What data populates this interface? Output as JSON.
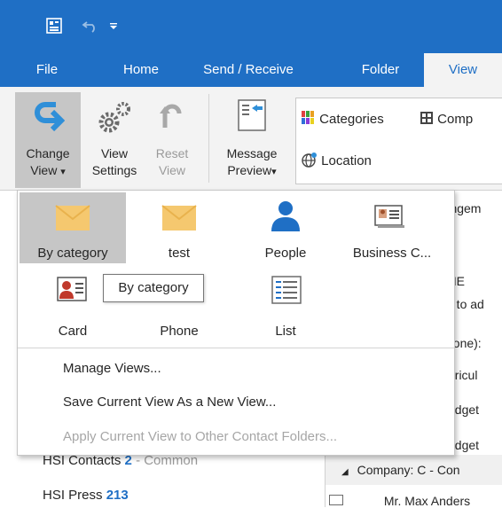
{
  "quick_access": {
    "icons": [
      "outlook-icon",
      "undo-icon",
      "customize-qat-icon"
    ]
  },
  "tabs": [
    "File",
    "Home",
    "Send / Receive",
    "Folder",
    "View"
  ],
  "active_tab": "View",
  "ribbon": {
    "change_view": {
      "line1": "Change",
      "line2": "View",
      "arrow": "▾"
    },
    "view_settings": {
      "line1": "View",
      "line2": "Settings"
    },
    "reset_view": {
      "line1": "Reset",
      "line2": "View"
    },
    "message_preview": {
      "line1": "Message",
      "line2": "Preview",
      "arrow": "▾"
    },
    "arrangement": {
      "categories": "Categories",
      "company": "Comp",
      "location": "Location"
    }
  },
  "dropdown": {
    "views": [
      {
        "label": "By category",
        "icon": "envelope-icon",
        "selected": true
      },
      {
        "label": "test",
        "icon": "envelope-icon",
        "selected": false
      },
      {
        "label": "People",
        "icon": "person-icon",
        "selected": false
      },
      {
        "label": "Business C...",
        "icon": "business-card-icon",
        "selected": false
      },
      {
        "label": "Card",
        "icon": "contact-card-icon",
        "selected": false
      },
      {
        "label": "Phone",
        "icon": "phone-icon",
        "selected": false
      },
      {
        "label": "List",
        "icon": "list-icon",
        "selected": false
      }
    ],
    "tooltip": "By category",
    "menu": {
      "manage": "Manage Views...",
      "save": "Save Current View As a New View...",
      "apply": "Apply Current View to Other Contact Folders..."
    }
  },
  "background": {
    "right_lines": [
      "rangem",
      "ME",
      "e to ad",
      "hone):",
      "gricul",
      "udget",
      "udget",
      "Company: C - Con",
      "Mr. Max Anders"
    ],
    "folders": [
      {
        "name": "HSI Contacts",
        "count": "2",
        "sub": "- Common"
      },
      {
        "name": "HSI Press",
        "count": "213",
        "sub": ""
      }
    ]
  },
  "colors": {
    "accent": "#1f6fc5",
    "envelope": "#f5c86f",
    "selected_bg": "#c6c6c6"
  }
}
